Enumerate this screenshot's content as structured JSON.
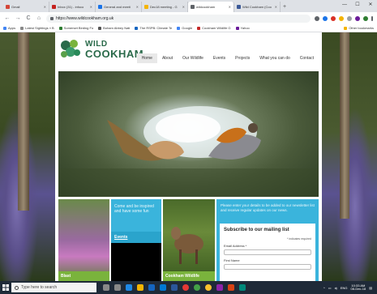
{
  "browser": {
    "tabs": [
      {
        "label": "Gmail",
        "color": "#d44638",
        "active": false
      },
      {
        "label": "Inbox (31) - infoco",
        "color": "#c5221f",
        "active": false
      },
      {
        "label": "General and meeti",
        "color": "#1a73e8",
        "active": false
      },
      {
        "label": "Dec18 meeting - G",
        "color": "#f4b400",
        "active": false
      },
      {
        "label": "wildcookham",
        "color": "#5f6368",
        "active": true
      },
      {
        "label": "Wild Cookham (Coo",
        "color": "#3b5998",
        "active": false
      }
    ],
    "new_tab": "+",
    "window_controls": {
      "minimize": "—",
      "maximize": "☐",
      "close": "✕"
    },
    "nav": {
      "back": "←",
      "forward": "→",
      "reload": "C",
      "home": "⌂"
    },
    "url": "https://www.wildcookham.org.uk",
    "bookmarks": [
      {
        "label": "Apps",
        "color": "#4285f4"
      },
      {
        "label": "Latest Sightings » B",
        "color": "#888888"
      },
      {
        "label": "Somerset Birding Fo",
        "color": "#2e7d32"
      },
      {
        "label": "Boham Abbey Nati",
        "color": "#555555"
      },
      {
        "label": "The RSPB: Climate Te",
        "color": "#1565c0"
      },
      {
        "label": "Google",
        "color": "#4285f4"
      },
      {
        "label": "Cookham Wildlife G",
        "color": "#c62828"
      },
      {
        "label": "Yahoo",
        "color": "#6a1b9a"
      }
    ],
    "other_bookmarks": "Other bookmarks"
  },
  "site": {
    "logo_line1": "WILD",
    "logo_line2": "COOKHAM",
    "nav": [
      {
        "label": "Home",
        "active": true
      },
      {
        "label": "About",
        "active": false
      },
      {
        "label": "Our Wildlife",
        "active": false
      },
      {
        "label": "Events",
        "active": false
      },
      {
        "label": "Projects",
        "active": false
      },
      {
        "label": "What you can do",
        "active": false
      },
      {
        "label": "Contact",
        "active": false
      }
    ],
    "tiles": {
      "tile1_label": "Blast",
      "tile2_text": "Come and be inspired and have some fun",
      "tile2_link": "Events",
      "tile3_label": "Cookham Wildlife",
      "newsletter_intro": "Please enter your details to be added to our newsletter list and receive regular updates on our news.",
      "form_title": "Subscribe to our mailing list",
      "required_note": "* indicates required",
      "email_label": "Email Address *",
      "first_name_label": "First Name"
    }
  },
  "taskbar": {
    "search_placeholder": "Type here to search",
    "tray_lang": "ENG",
    "time": "10:33 AM",
    "date": "08-Dec-18"
  }
}
